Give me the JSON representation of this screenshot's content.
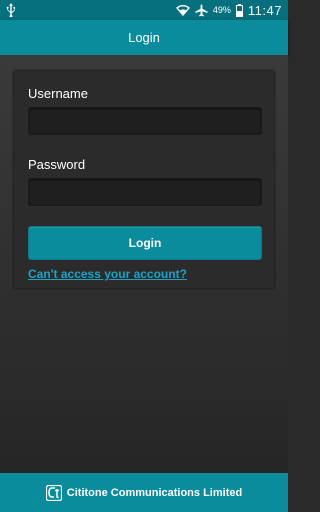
{
  "colors": {
    "accent": "#0a8c9c",
    "status_bar": "#06707f",
    "link": "#1aa4c8",
    "background": "#2a2a2a"
  },
  "status_bar": {
    "icons": [
      "usb-icon",
      "wifi-icon",
      "airplane-mode-icon",
      "battery-icon"
    ],
    "battery_percent": "49%",
    "time": "11:47"
  },
  "app_bar": {
    "title": "Login"
  },
  "form": {
    "username_label": "Username",
    "username_value": "",
    "password_label": "Password",
    "password_value": "",
    "login_button": "Login",
    "help_link": "Can't access your account?"
  },
  "footer": {
    "logo_icon": "cititone-logo-icon",
    "company_name": "Cititone Communications Limited"
  }
}
